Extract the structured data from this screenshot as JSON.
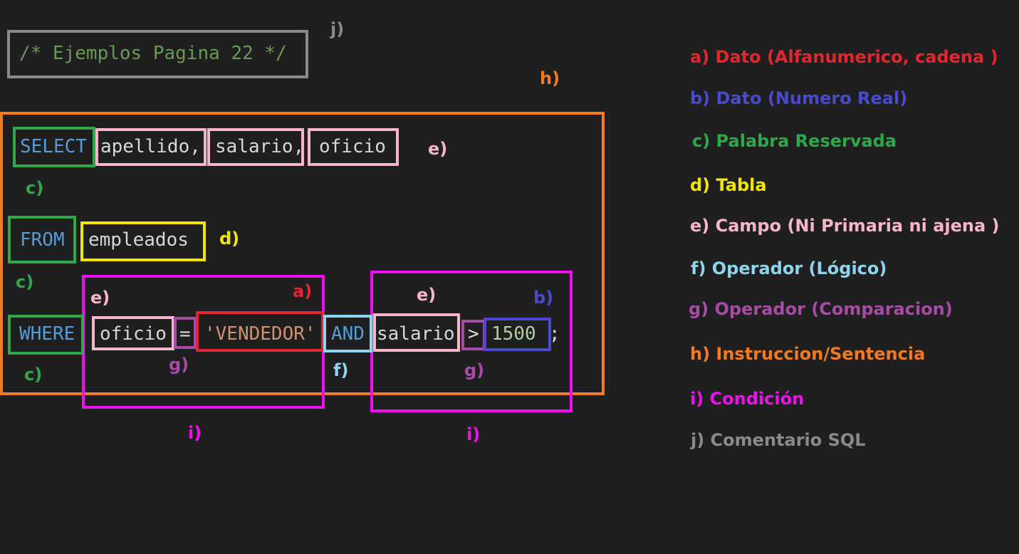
{
  "colors": {
    "background": "#1f1f1f",
    "data_string": "#e3262f",
    "data_number": "#4a4ad0",
    "keyword": "#2ea84a",
    "table": "#f2e600",
    "field": "#f4b6c8",
    "logical_operator": "#8fd4ee",
    "comparison_operator": "#a64ca6",
    "statement": "#f07b22",
    "condition": "#ee10ee",
    "comment": "#8a8a8a",
    "code_keyword": "#569cd6",
    "code_text": "#d8d8d8",
    "code_string": "#ce9178",
    "code_number": "#b5cea8",
    "code_comment": "#6a9955"
  },
  "code": {
    "comment": "/* Ejemplos Pagina 22 */",
    "select_kw": "SELECT",
    "field_apellido": "apellido,",
    "field_salario": "salario,",
    "field_oficio": "oficio",
    "from_kw": "FROM",
    "table_name": "empleados",
    "where_kw": "WHERE",
    "cond1_field": "oficio",
    "cond1_operator": "=",
    "cond1_value": "'VENDEDOR'",
    "logical_op": "AND",
    "cond2_field": "salario",
    "cond2_operator": ">",
    "cond2_value": "1500",
    "terminator": ";"
  },
  "tags": {
    "j": "j)",
    "h": "h)",
    "e_select": "e)",
    "c_select": "c)",
    "d_from": "d)",
    "c_from": "c)",
    "e_cond1": "e)",
    "a_cond1": "a)",
    "e_cond2": "e)",
    "b_cond2": "b)",
    "c_where": "c)",
    "g_cond1": "g)",
    "f_and": "f)",
    "g_cond2": "g)",
    "i_cond1": "i)",
    "i_cond2": "i)"
  },
  "legend": [
    {
      "label": "a) Dato (Alfanumerico, cadena )",
      "color": "#e3262f"
    },
    {
      "label": "b) Dato (Numero Real)",
      "color": "#4a4ad0"
    },
    {
      "label": "c) Palabra Reservada",
      "color": "#2ea84a"
    },
    {
      "label": "d) Tabla",
      "color": "#f2e600"
    },
    {
      "label": "e) Campo (Ni Primaria ni ajena )",
      "color": "#f4b6c8"
    },
    {
      "label": "f) Operador (Lógico)",
      "color": "#8fd4ee"
    },
    {
      "label": "g) Operador (Comparacion)",
      "color": "#a64ca6"
    },
    {
      "label": "h) Instruccion/Sentencia",
      "color": "#f07b22"
    },
    {
      "label": "i) Condición",
      "color": "#ee10ee"
    },
    {
      "label": "j) Comentario SQL",
      "color": "#8a8a8a"
    }
  ]
}
